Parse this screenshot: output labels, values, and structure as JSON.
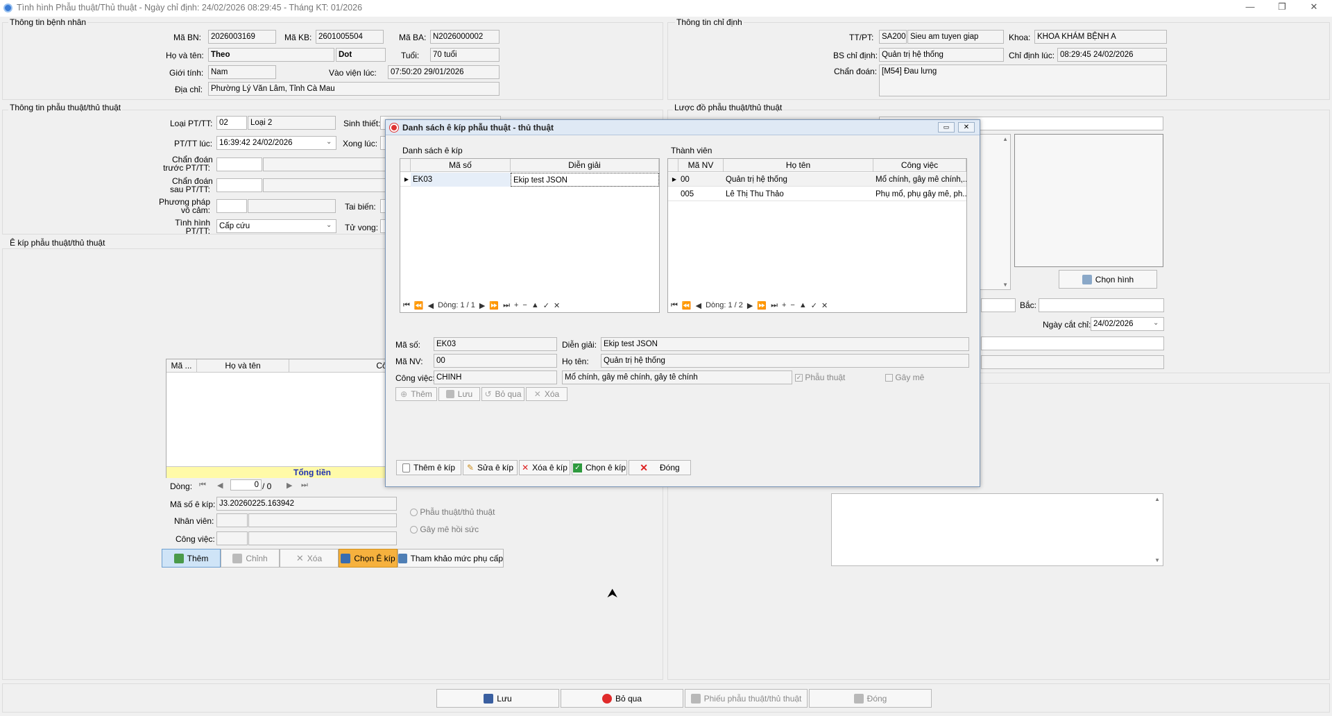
{
  "window": {
    "title": "Tình hình Phẫu thuật/Thủ thuật - Ngày chỉ định: 24/02/2026 08:29:45 - Tháng KT: 01/2026",
    "minimize": "—",
    "maximize": "❐",
    "close": "✕"
  },
  "patient": {
    "section": "Thông tin bệnh nhân",
    "ma_bn_label": "Mã BN:",
    "ma_bn": "2026003169",
    "ma_kb_label": "Mã KB:",
    "ma_kb": "2601005504",
    "ma_ba_label": "Mã BA:",
    "ma_ba": "N2026000002",
    "ho_ten_label": "Họ và tên:",
    "ho": "Theo",
    "ten": "Dot",
    "tuoi_label": "Tuổi:",
    "tuoi": "70 tuổi",
    "gioi_tinh_label": "Giới tính:",
    "gioi_tinh": "Nam",
    "vao_vien_label": "Vào viện lúc:",
    "vao_vien": "07:50:20 29/01/2026",
    "dia_chi_label": "Địa chỉ:",
    "dia_chi": "Phường Lý Văn Lâm, Tỉnh Cà Mau"
  },
  "order": {
    "section": "Thông tin chỉ định",
    "tt_pt_label": "TT/PT:",
    "tt_pt_code": "SA200",
    "tt_pt_name": "Sieu am tuyen giap",
    "khoa_label": "Khoa:",
    "khoa": "KHOA KHÁM BỆNH A",
    "bs_label": "BS chỉ định:",
    "bs": "Quản trị hệ thống",
    "chi_dinh_luc_label": "Chỉ định lúc:",
    "chi_dinh_luc": "08:29:45 24/02/2026",
    "chan_doan_label": "Chẩn đoán:",
    "chan_doan": "[M54] Đau lưng"
  },
  "surgery": {
    "section": "Thông tin phẫu thuật/thủ thuật",
    "loai_label": "Loại PT/TT:",
    "loai_code": "02",
    "loai_name": "Loại 2",
    "sinh_thiet_label": "Sinh thiết:",
    "pt_luc_label": "PT/TT lúc:",
    "pt_luc": "16:39:42 24/02/2026",
    "xong_luc_label": "Xong lúc:",
    "cd_truoc_label_1": "Chẩn đoán",
    "cd_truoc_label_2": "trước PT/TT:",
    "cd_sau_label_1": "Chẩn đoán",
    "cd_sau_label_2": "sau PT/TT:",
    "pp_label_1": "Phương pháp",
    "pp_label_2": "vô cảm:",
    "tai_bien_label": "Tai biến:",
    "tinh_hinh_label_1": "Tình hình",
    "tinh_hinh_label_2": "PT/TT:",
    "tinh_hinh": "Cấp cứu",
    "tu_vong_label": "Tử vong:"
  },
  "diagram": {
    "section": "Lược đồ phẫu thuật/thủ thuật",
    "chon_hinh": "Chọn hình",
    "bac_label": "Bắc:",
    "ngay_cat_chi_label": "Ngày cắt chỉ:",
    "ngay_cat_chi": "24/02/2026"
  },
  "ekip": {
    "section": "Ê kíp phẫu thuật/thủ thuật",
    "col_ma": "Mã ...",
    "col_ho_ten": "Họ và tên",
    "col_cong_viec": "Công việc",
    "tong_tien": "Tổng tiền",
    "dong_label": "Dòng:",
    "dong_value": "0",
    "dong_total": "/ 0",
    "ma_so_label": "Mã số ê kíp:",
    "ma_so": "J3.20260225.163942",
    "nhan_vien_label": "Nhân viên:",
    "cong_viec_label": "Công việc:",
    "radio_pt": "Phẫu thuật/thủ thuật",
    "radio_gm": "Gây mê hồi sức",
    "btn_them": "Thêm",
    "btn_chinh": "Chỉnh",
    "btn_xoa": "Xóa",
    "btn_chon": "Chọn Ê kíp",
    "btn_tham_khao": "Tham khảo mức phụ cấp"
  },
  "dialog": {
    "title": "Danh sách ê kíp phẫu thuật - thủ thuật",
    "list_section": "Danh sách ê kíp",
    "col_ma_so": "Mã số",
    "col_dien_giai": "Diễn giải",
    "ekips": [
      {
        "ma_so": "EK03",
        "dien_giai": "Ekip test JSON"
      }
    ],
    "list_nav": "Dòng: 1 / 1",
    "members_section": "Thành viên",
    "col_ma_nv": "Mã NV",
    "col_ho_ten": "Họ tên",
    "col_cong_viec": "Công việc",
    "members": [
      {
        "ma_nv": "00",
        "ho_ten": "Quản trị hệ thống",
        "cong_viec": "Mổ chính, gây mê chính,..."
      },
      {
        "ma_nv": "005",
        "ho_ten": "Lê Thị Thu Thảo",
        "cong_viec": "Phụ mổ, phụ gây mê, ph..."
      }
    ],
    "members_nav": "Dòng: 1 / 2",
    "ma_so_label": "Mã số:",
    "ma_so": "EK03",
    "dien_giai_label": "Diễn giải:",
    "dien_giai": "Ekip test JSON",
    "ma_nv_label": "Mã NV:",
    "ma_nv": "00",
    "ho_ten_label": "Họ tên:",
    "ho_ten": "Quản trị hệ thống",
    "cong_viec_label": "Công việc:",
    "cong_viec_code": "CHINH",
    "cong_viec_desc": "Mổ chính, gây mê chính, gây tê chính",
    "chk_phau_thuat": "Phẫu thuật",
    "chk_gay_me": "Gây mê",
    "btn_them": "Thêm",
    "btn_luu": "Lưu",
    "btn_bo_qua": "Bỏ qua",
    "btn_xoa": "Xóa",
    "btn_them_ekip": "Thêm ê kíp",
    "btn_sua_ekip": "Sửa ê kíp",
    "btn_xoa_ekip": "Xóa  ê kíp",
    "btn_chon_ekip": "Chọn  ê kíp",
    "btn_dong": "Đóng"
  },
  "footer": {
    "luu": "Lưu",
    "bo_qua": "Bỏ qua",
    "phieu": "Phiếu phẫu thuật/thủ thuật",
    "dong": "Đóng"
  }
}
